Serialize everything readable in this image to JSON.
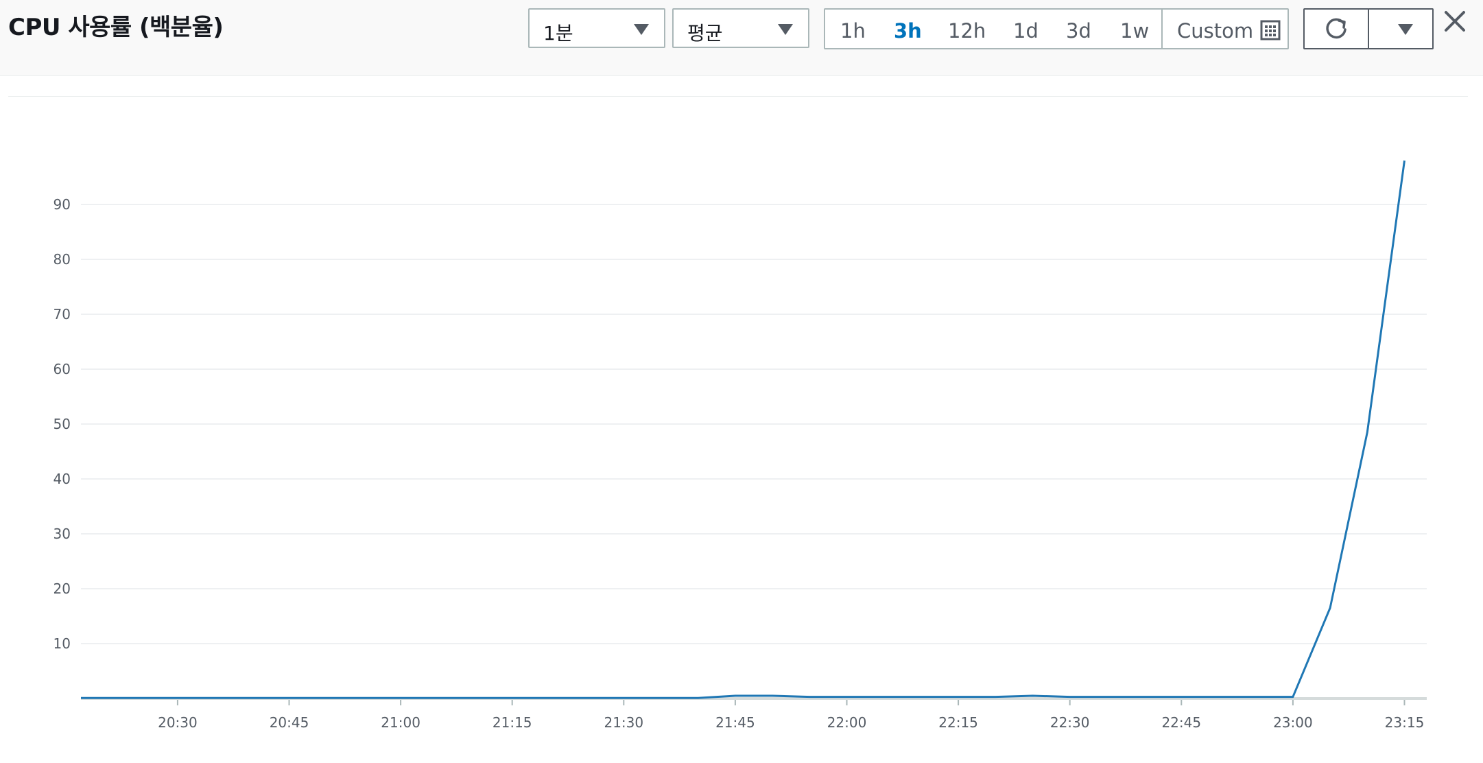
{
  "header": {
    "title": "CPU 사용률 (백분율)",
    "period_select": {
      "value": "1분"
    },
    "stat_select": {
      "value": "평균"
    },
    "time_range": {
      "options": [
        "1h",
        "3h",
        "12h",
        "1d",
        "3d",
        "1w"
      ],
      "active": "3h",
      "custom_label": "Custom"
    },
    "icons": {
      "calendar": "calendar-icon",
      "refresh": "refresh-icon",
      "dropdown": "chevron-down-icon",
      "close": "close-icon"
    }
  },
  "colors": {
    "line": "#1f77b4",
    "active_range": "#0073bb"
  },
  "chart_data": {
    "type": "line",
    "title": "CPU 사용률 (백분율)",
    "xlabel": "",
    "ylabel": "",
    "x_ticks": [
      "20:30",
      "20:45",
      "21:00",
      "21:15",
      "21:30",
      "21:45",
      "22:00",
      "22:15",
      "22:30",
      "22:45",
      "23:00",
      "23:15"
    ],
    "y_ticks": [
      10,
      20,
      30,
      40,
      50,
      60,
      70,
      80,
      90
    ],
    "ylim": [
      0,
      100
    ],
    "xlim": [
      "20:17",
      "23:18"
    ],
    "grid": true,
    "series": [
      {
        "x": [
          "20:17",
          "20:30",
          "20:45",
          "21:00",
          "21:15",
          "21:30",
          "21:40",
          "21:45",
          "21:50",
          "21:55",
          "22:00",
          "22:15",
          "22:20",
          "22:25",
          "22:30",
          "22:45",
          "22:55",
          "23:00",
          "23:05",
          "23:10",
          "23:15"
        ],
        "values": [
          0.1,
          0.1,
          0.1,
          0.1,
          0.1,
          0.1,
          0.1,
          0.5,
          0.5,
          0.3,
          0.3,
          0.3,
          0.3,
          0.5,
          0.3,
          0.3,
          0.3,
          0.3,
          16.5,
          48.5,
          98
        ]
      }
    ]
  }
}
